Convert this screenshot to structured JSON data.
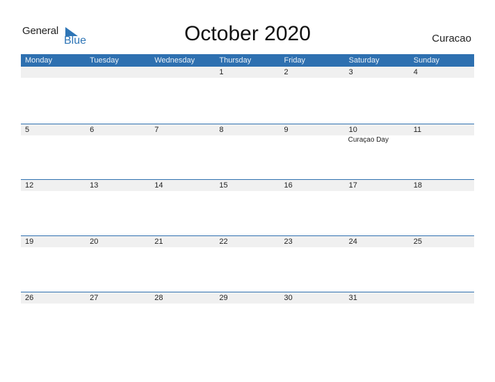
{
  "logo": {
    "general": "General",
    "blue": "Blue"
  },
  "title": "October 2020",
  "country": "Curacao",
  "colors": {
    "accent": "#2e70b0",
    "band": "#f0f0f0"
  },
  "weekdays": [
    "Monday",
    "Tuesday",
    "Wednesday",
    "Thursday",
    "Friday",
    "Saturday",
    "Sunday"
  ],
  "weeks": [
    {
      "days": [
        "",
        "",
        "",
        "1",
        "2",
        "3",
        "4"
      ],
      "events": [
        "",
        "",
        "",
        "",
        "",
        "",
        ""
      ]
    },
    {
      "days": [
        "5",
        "6",
        "7",
        "8",
        "9",
        "10",
        "11"
      ],
      "events": [
        "",
        "",
        "",
        "",
        "",
        "Curaçao Day",
        ""
      ]
    },
    {
      "days": [
        "12",
        "13",
        "14",
        "15",
        "16",
        "17",
        "18"
      ],
      "events": [
        "",
        "",
        "",
        "",
        "",
        "",
        ""
      ]
    },
    {
      "days": [
        "19",
        "20",
        "21",
        "22",
        "23",
        "24",
        "25"
      ],
      "events": [
        "",
        "",
        "",
        "",
        "",
        "",
        ""
      ]
    },
    {
      "days": [
        "26",
        "27",
        "28",
        "29",
        "30",
        "31",
        ""
      ],
      "events": [
        "",
        "",
        "",
        "",
        "",
        "",
        ""
      ]
    }
  ]
}
